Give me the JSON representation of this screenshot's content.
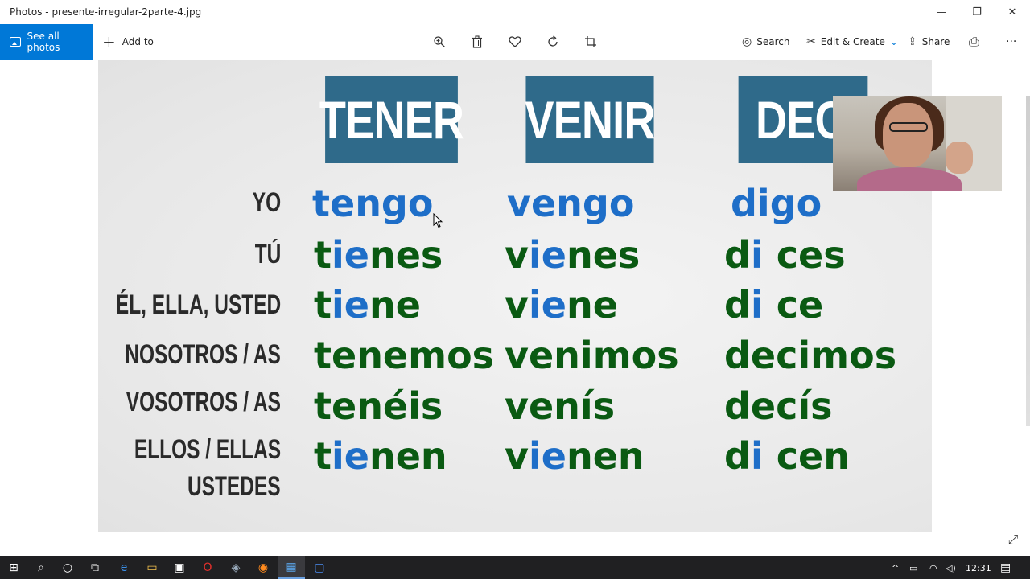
{
  "window": {
    "title": "Photos - presente-irregular-2parte-4.jpg",
    "minimize": "—",
    "restore": "❐",
    "close": "✕"
  },
  "toolbar": {
    "see_all": "See all photos",
    "add_to": "Add to",
    "add_glyph": "+",
    "search": "Search",
    "edit_create": "Edit & Create",
    "share": "Share",
    "more": "···",
    "icons": {
      "zoom": "zoom-icon",
      "delete": "trash-icon",
      "favorite": "heart-icon",
      "rotate": "rotate-icon",
      "crop": "crop-icon",
      "search": "search-icon",
      "edit": "edit-create-icon",
      "share": "share-icon",
      "print": "print-icon"
    },
    "glyphs": {
      "zoom": "⌕",
      "delete": "🗑",
      "favorite": "♡",
      "rotate": "↻",
      "crop": "⌗",
      "search": "◎",
      "edit": "✂",
      "chevron": "⌄",
      "share": "⇪",
      "print": "⎙"
    }
  },
  "photo": {
    "headers": [
      "TENER",
      "VENIR",
      "DECI"
    ],
    "pronouns": [
      "YO",
      "TÚ",
      "ÉL, ELLA, USTED",
      "NOSOTROS / AS",
      "VOSOTROS / AS",
      "ELLOS / ELLAS",
      "USTEDES"
    ],
    "tener": [
      "tengo",
      "t",
      "ie",
      "nes",
      "t",
      "ie",
      "ne",
      "tenemos",
      "tenéis",
      "t",
      "ie",
      "nen"
    ],
    "venir": [
      "vengo",
      "v",
      "ie",
      "nes",
      "v",
      "ie",
      "ne",
      "venimos",
      "venís",
      "v",
      "ie",
      "nen"
    ],
    "decir": [
      "digo",
      "d",
      "i",
      " ces",
      "d",
      "i",
      " ce",
      "decimos",
      "decís",
      "d",
      "i",
      " cen"
    ]
  },
  "taskbar": {
    "start": "⊞",
    "search": "⌕",
    "cortana": "○",
    "taskview": "⧉",
    "edge": "e",
    "explorer": "▭",
    "store": "▣",
    "opera": "O",
    "app": "◈",
    "firefox": "◉",
    "photos": "▦",
    "zoom": "▢",
    "tray_arrow": "^",
    "battery": "▭",
    "wifi": "◠",
    "volume": "◁)",
    "clock": "12:31",
    "notifications": "▤"
  },
  "fullscreen_glyph": "⤢"
}
